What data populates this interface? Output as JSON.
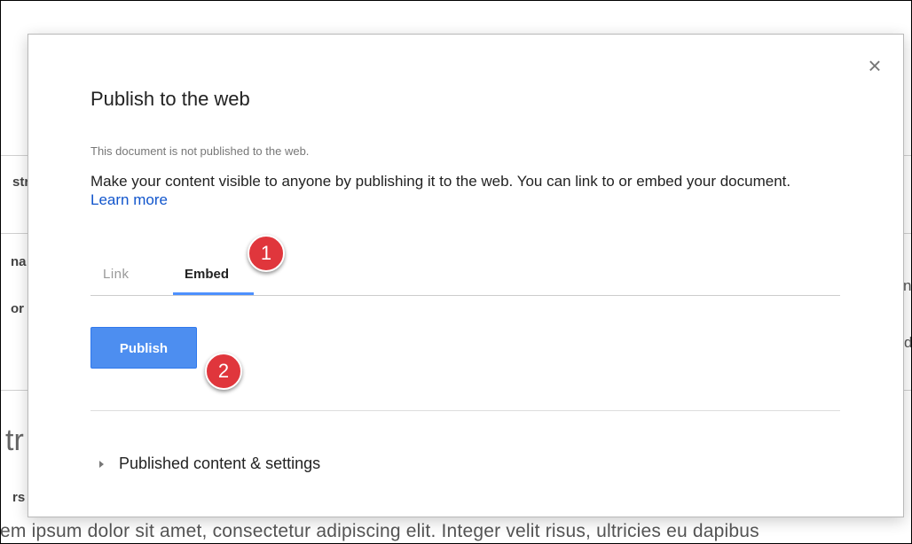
{
  "background": {
    "fragments": {
      "left_1": "str",
      "left_2": "na",
      "left_3": "or",
      "left_big": "tr",
      "left_4": "rs",
      "right_1": "ne",
      "right_2": "d"
    },
    "body_text": "em ipsum dolor sit amet, consectetur adipiscing elit. Integer velit risus, ultricies eu dapibus"
  },
  "dialog": {
    "close_symbol": "×",
    "title": "Publish to the web",
    "status_note": "This document is not published to the web.",
    "description": "Make your content visible to anyone by publishing it to the web. You can link to or embed your document.",
    "learn_more": "Learn more",
    "tabs": [
      {
        "label": "Link",
        "selected": false
      },
      {
        "label": "Embed",
        "selected": true
      }
    ],
    "publish_label": "Publish",
    "settings_label": "Published content & settings"
  },
  "callouts": [
    "1",
    "2"
  ],
  "colors": {
    "accent": "#4d90fe",
    "button": "#4d8ef0",
    "link": "#1155cc",
    "callout": "#e0363c"
  },
  "icons": {
    "close": "close-icon",
    "expander": "triangle-right-icon"
  }
}
